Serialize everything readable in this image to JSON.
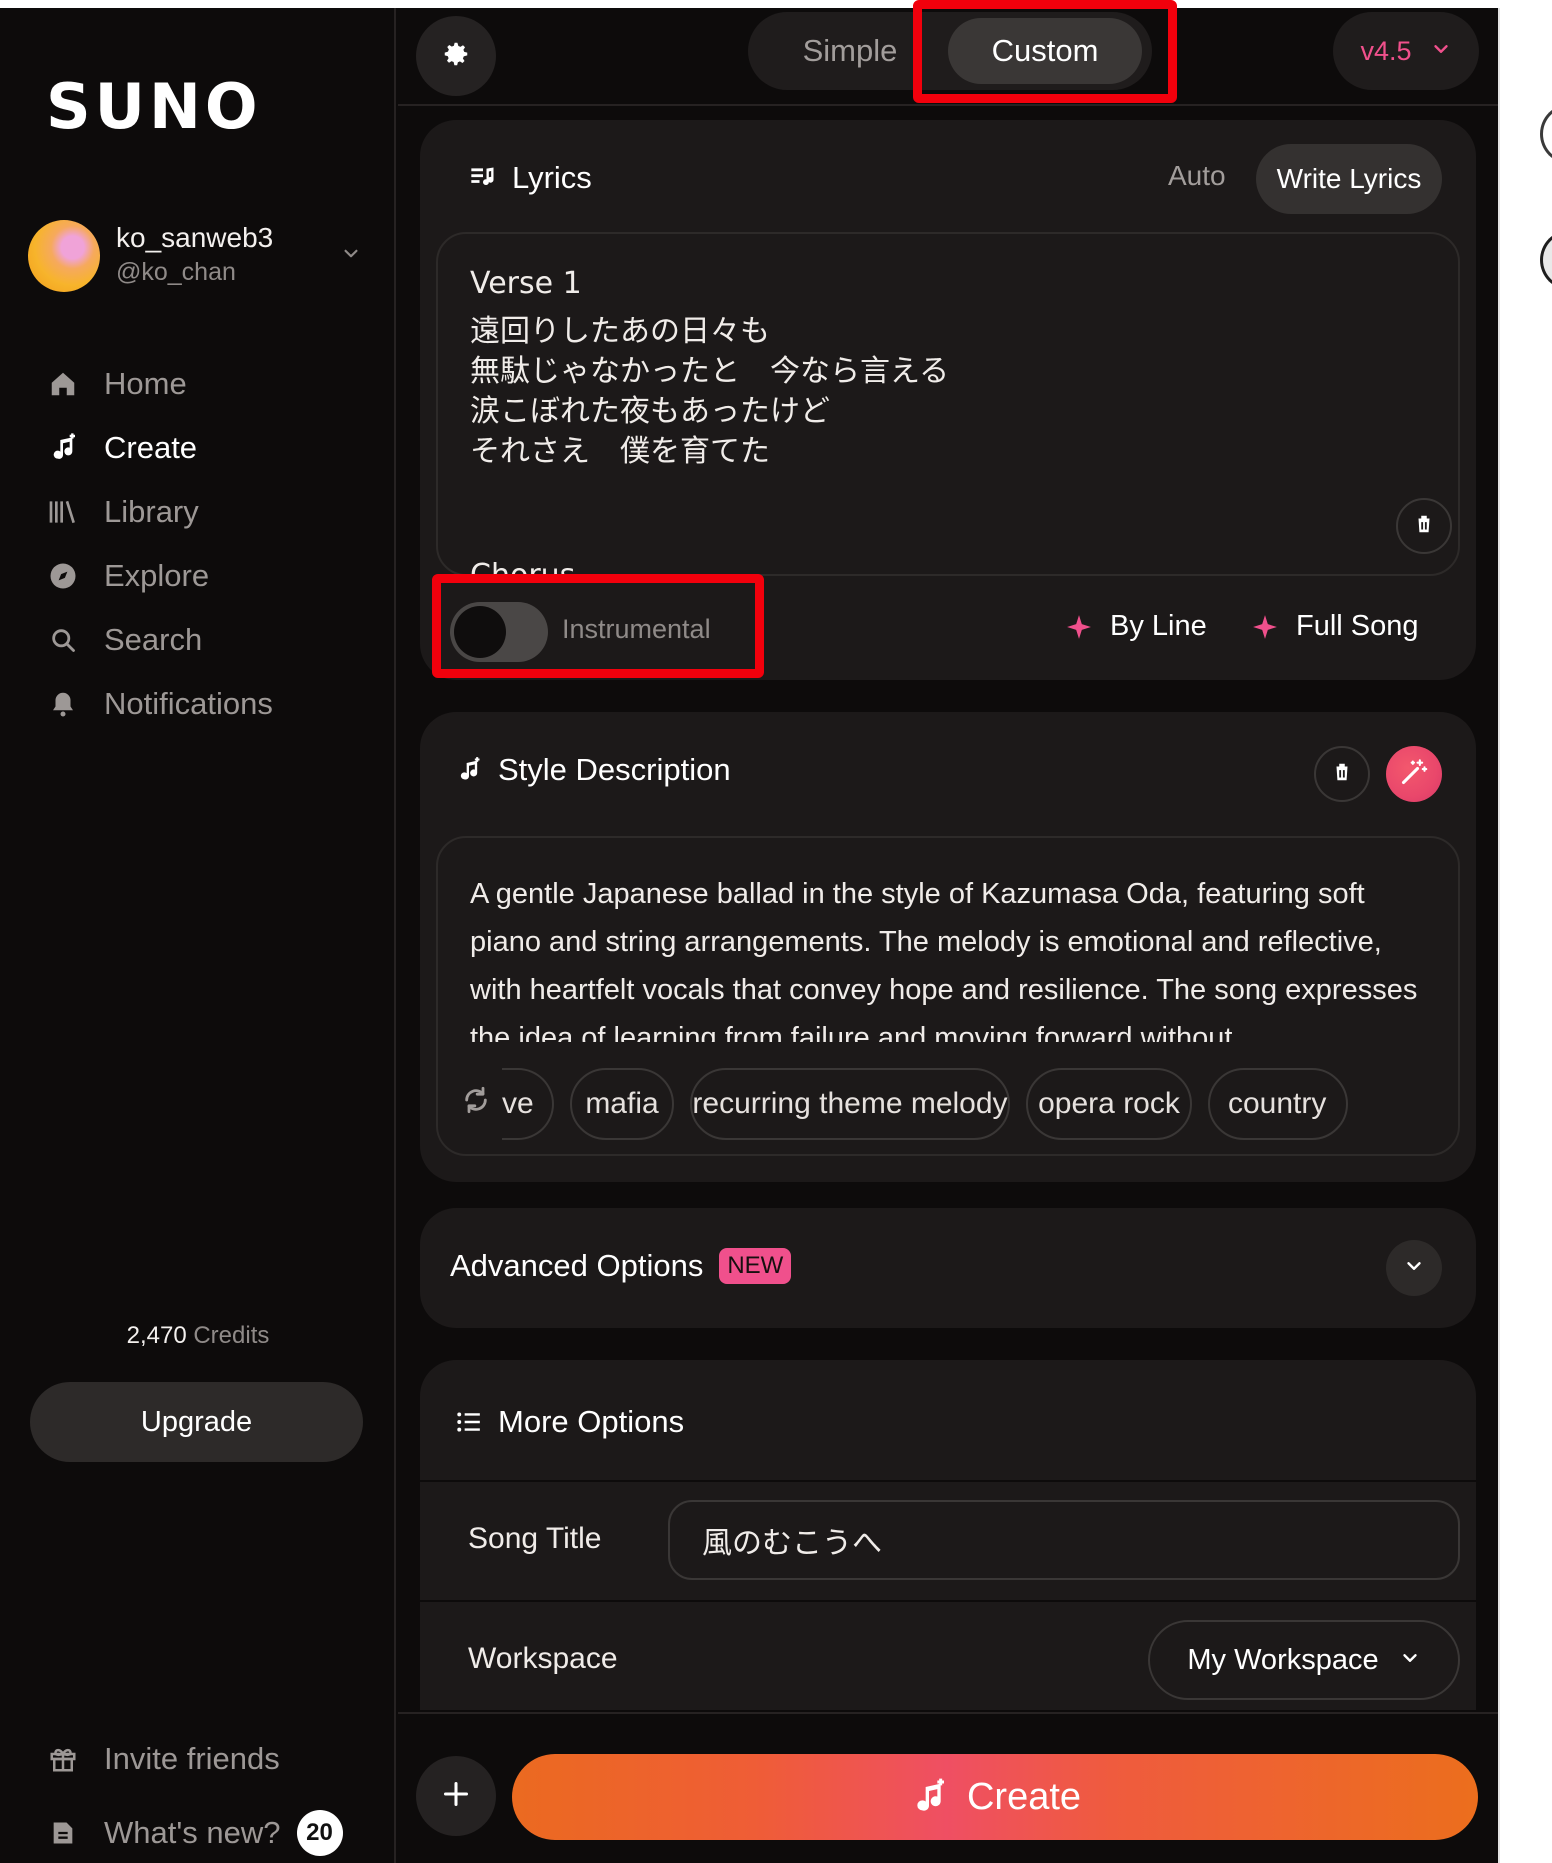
{
  "brand": {
    "logo_text": "SUNO"
  },
  "user": {
    "name": "ko_sanweb3",
    "handle": "@ko_chan"
  },
  "sidebar": {
    "items": [
      {
        "label": "Home",
        "icon": "home-icon"
      },
      {
        "label": "Create",
        "icon": "create-music-icon",
        "active": true
      },
      {
        "label": "Library",
        "icon": "library-icon"
      },
      {
        "label": "Explore",
        "icon": "compass-icon"
      },
      {
        "label": "Search",
        "icon": "search-icon"
      },
      {
        "label": "Notifications",
        "icon": "bell-icon"
      }
    ],
    "credits_value": "2,470",
    "credits_label": "Credits",
    "upgrade_label": "Upgrade",
    "invite_label": "Invite friends",
    "whatsnew_label": "What's new?",
    "whatsnew_count": "20"
  },
  "topbar": {
    "mode_simple": "Simple",
    "mode_custom": "Custom",
    "active_mode": "Custom",
    "version": "v4.5"
  },
  "lyrics": {
    "title": "Lyrics",
    "mode_auto": "Auto",
    "mode_write": "Write Lyrics",
    "lines": [
      "Verse 1",
      "遠回りしたあの日々も",
      "無駄じゃなかったと　今なら言える",
      "涙こぼれた夜もあったけど",
      "それさえ　僕を育てた",
      "Chorus"
    ],
    "instrumental_label": "Instrumental",
    "instrumental_on": false,
    "by_line_label": "By Line",
    "full_song_label": "Full Song"
  },
  "style": {
    "title": "Style Description",
    "text": "A gentle Japanese ballad in the style of Kazumasa Oda, featuring soft piano and string arrangements. The melody is emotional and reflective, with heartfelt vocals that convey hope and resilience. The song expresses the idea of learning from failure and moving forward without",
    "tags": [
      "ve",
      "mafia",
      "recurring theme melody",
      "opera rock",
      "country"
    ]
  },
  "advanced": {
    "title": "Advanced Options",
    "badge": "NEW"
  },
  "more_options": {
    "title": "More Options",
    "song_title_label": "Song Title",
    "song_title_value": "風のむこうへ",
    "workspace_label": "Workspace",
    "workspace_value": "My Workspace"
  },
  "create_button": {
    "label": "Create"
  },
  "colors": {
    "accent_pink": "#f0508c",
    "highlight_red": "#f2000c",
    "create_gradient_start": "#eb6a20",
    "create_gradient_mid": "#ef4f63"
  }
}
